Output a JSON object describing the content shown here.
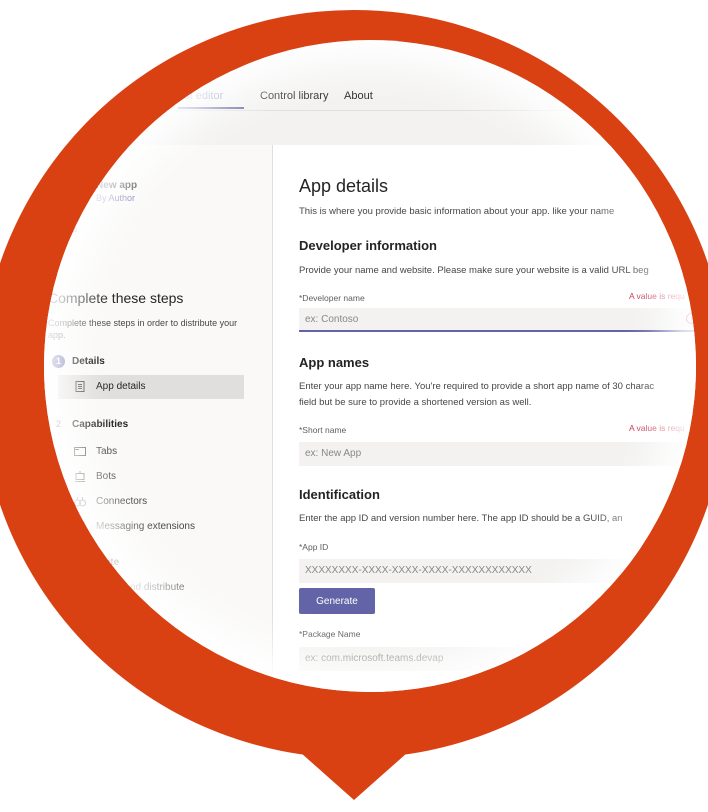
{
  "topbar": {
    "tabs": [
      {
        "label": "Manifest editor",
        "visible": "est editor"
      },
      {
        "label": "Control library"
      },
      {
        "label": "About"
      }
    ]
  },
  "sidebar": {
    "app_name": "New app",
    "app_author": "By Author",
    "capabilities_link": "pabilities",
    "steps_title": "Complete these steps",
    "steps_desc": "Complete these steps in order to distribute your app.",
    "step1": {
      "num": "1",
      "label": "Details",
      "items": [
        {
          "label": "App details",
          "icon": "document-icon"
        }
      ]
    },
    "step2": {
      "num": "2",
      "label": "Capabilities",
      "items": [
        {
          "label": "Tabs",
          "icon": "tab-icon"
        },
        {
          "label": "Bots",
          "icon": "bot-icon"
        },
        {
          "label": "Connectors",
          "icon": "connector-icon"
        },
        {
          "label": "Messaging extensions",
          "icon": "messaging-extension-icon"
        }
      ]
    },
    "distribute_head": "bute",
    "distribute_item": "nd distribute"
  },
  "main": {
    "title": "App details",
    "intro": "This is where you provide basic information about your app. like your name",
    "developer": {
      "heading": "Developer information",
      "desc": "Provide your name and website. Please make sure your website is a valid URL beg",
      "name_label": "*Developer name",
      "name_error": "A value is requ",
      "name_placeholder": "ex: Contoso"
    },
    "app_names": {
      "heading": "App names",
      "desc_line1": "Enter your app name here. You're required to provide a short app name of 30 charac",
      "desc_line2": "field but be sure to provide a shortened version as well.",
      "short_label": "*Short name",
      "short_error": "A value is requ",
      "short_placeholder": "ex: New App"
    },
    "identification": {
      "heading": "Identification",
      "desc": "Enter the app ID and version number here. The app ID should be a GUID, an",
      "appid_label": "*App ID",
      "appid_placeholder": "XXXXXXXX-XXXX-XXXX-XXXX-XXXXXXXXXXXX",
      "generate_label": "Generate",
      "package_label": "*Package Name",
      "package_placeholder": "ex: com.microsoft.teams.devap"
    }
  },
  "colors": {
    "pin": "#d94012",
    "accent": "#6264a7",
    "error": "#c4314b"
  }
}
